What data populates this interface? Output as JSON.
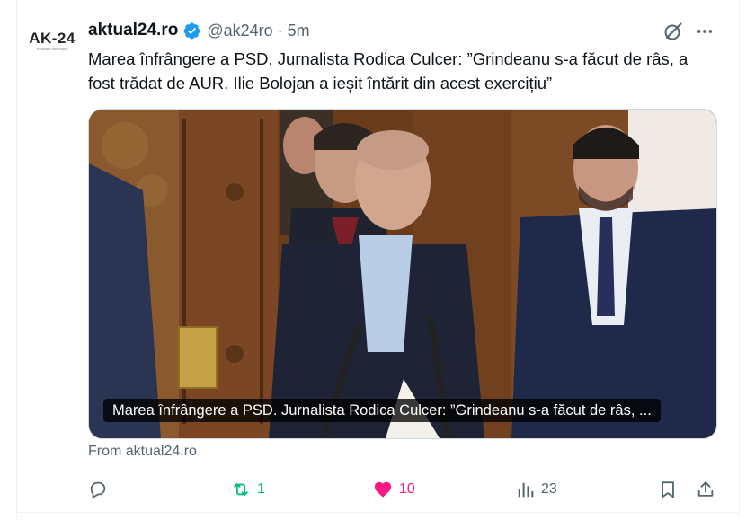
{
  "avatar": {
    "logo_text": "AK-24",
    "sub_text": "Realitate fara dopaj"
  },
  "author": {
    "name": "aktual24.ro",
    "handle": "@ak24ro",
    "separator": "·",
    "time": "5m",
    "verified": true
  },
  "header_icons": [
    "grok-icon",
    "more-icon"
  ],
  "tweet": {
    "text": "Marea înfrângere a PSD. Jurnalista Rodica Culcer: ”Grindeanu s-a făcut de râs, a fost trădat de AUR. Ilie Bolojan a ieșit întărit din acest exercițiu”"
  },
  "media": {
    "caption": "Marea înfrângere a PSD. Jurnalista Rodica Culcer: ”Grindeanu s-a făcut de râs, ..."
  },
  "source": {
    "text": "From aktual24.ro"
  },
  "actions": {
    "reply": {
      "icon": "reply-icon",
      "count": ""
    },
    "retweet": {
      "icon": "retweet-icon",
      "count": "1"
    },
    "like": {
      "icon": "heart-icon",
      "count": "10"
    },
    "views": {
      "icon": "views-icon",
      "count": "23"
    },
    "bookmark": {
      "icon": "bookmark-icon"
    },
    "share": {
      "icon": "share-icon"
    }
  },
  "colors": {
    "text": "#0f1419",
    "secondary": "#536471",
    "verified": "#1d9bf0",
    "retweet": "#00ba7c",
    "like": "#f91880",
    "border": "#cfd9de"
  }
}
